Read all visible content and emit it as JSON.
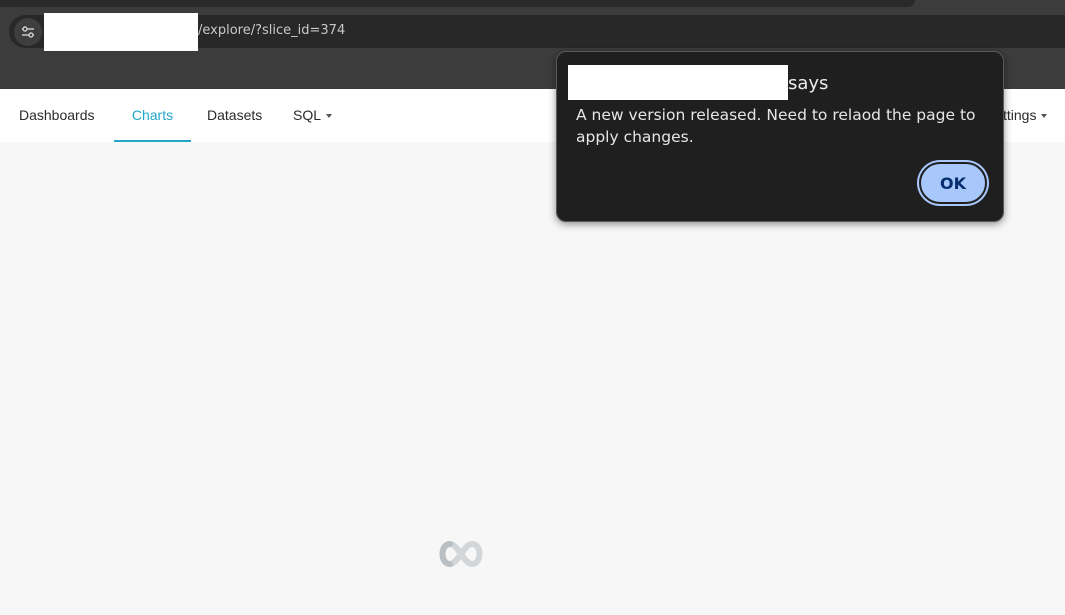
{
  "browser": {
    "url_suffix": "/explore/?slice_id=374",
    "site_info_icon": "tune-icon"
  },
  "nav": {
    "items": [
      {
        "label": "Dashboards",
        "active": false
      },
      {
        "label": "Charts",
        "active": true
      },
      {
        "label": "Datasets",
        "active": false
      },
      {
        "label": "SQL",
        "active": false,
        "has_dropdown": true
      }
    ],
    "right_item": {
      "label": "ttings",
      "has_dropdown": true
    }
  },
  "dialog": {
    "says": "says",
    "message": "A new version released. Need to relaod the page to apply changes.",
    "ok_label": "OK"
  },
  "colors": {
    "accent": "#20a7c9",
    "ok_button": "#a8c7fa",
    "dialog_bg": "#1f1f1f"
  },
  "loader_icon": "superset-loading-icon"
}
